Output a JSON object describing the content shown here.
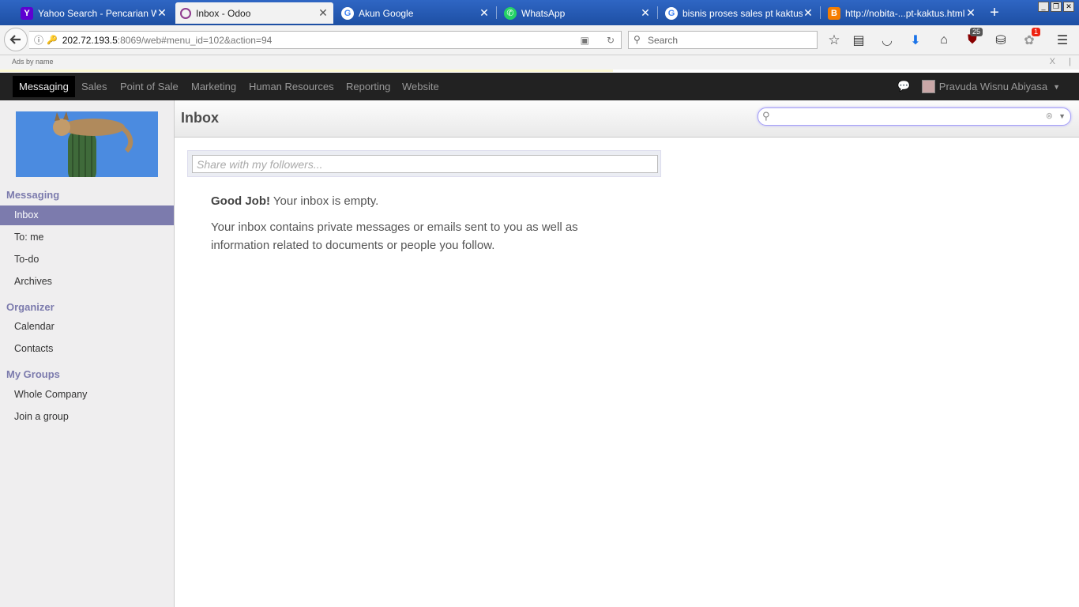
{
  "browser": {
    "tabs": [
      {
        "title": "Yahoo Search - Pencarian W...",
        "favicon": "yahoo-icon",
        "active": false
      },
      {
        "title": "Inbox - Odoo",
        "favicon": "odoo-icon",
        "active": true
      },
      {
        "title": "Akun Google",
        "favicon": "google-icon",
        "active": false
      },
      {
        "title": "WhatsApp",
        "favicon": "whatsapp-icon",
        "active": false
      },
      {
        "title": "bisnis proses sales pt kaktus...",
        "favicon": "google-icon",
        "active": false
      },
      {
        "title": "http://nobita-...pt-kaktus.html",
        "favicon": "blogger-icon",
        "active": false
      }
    ],
    "url_host": "202.72.193.5",
    "url_path": ":8069/web#menu_id=102&action=94",
    "search_placeholder": "Search",
    "badge_count_ublock": "25",
    "badge_count_notif": "1",
    "ads_label": "Ads by name",
    "ads_close": "X",
    "ads_sep": "|"
  },
  "odoo": {
    "top_menu": [
      "Messaging",
      "Sales",
      "Point of Sale",
      "Marketing",
      "Human Resources",
      "Reporting",
      "Website"
    ],
    "user_name": "Pravuda Wisnu Abiyasa",
    "sidebar": {
      "sections": [
        {
          "title": "Messaging",
          "items": [
            "Inbox",
            "To: me",
            "To-do",
            "Archives"
          ]
        },
        {
          "title": "Organizer",
          "items": [
            "Calendar",
            "Contacts"
          ]
        },
        {
          "title": "My Groups",
          "items": [
            "Whole Company",
            "Join a group"
          ]
        }
      ]
    },
    "page_title": "Inbox",
    "composer_placeholder": "Share with my followers...",
    "empty_title": "Good Job!",
    "empty_subtitle": " Your inbox is empty.",
    "empty_body": "Your inbox contains private messages or emails sent to you as well as information related to documents or people you follow."
  },
  "colors": {
    "accent": "#7c7bad",
    "topbar": "#222222",
    "tabstrip": "#2f66c4"
  }
}
